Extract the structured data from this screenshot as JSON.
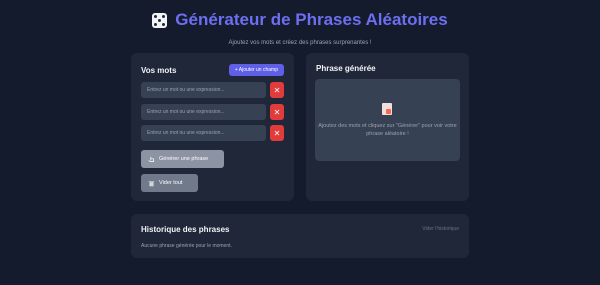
{
  "header": {
    "title": "Générateur de Phrases Aléatoires",
    "subtitle": "Ajoutez vos mots et créez des phrases surprenantes !"
  },
  "words_panel": {
    "title": "Vos mots",
    "add_label": "+ Ajouter un champ",
    "inputs": [
      {
        "placeholder": "Entrez un mot ou une expression...",
        "value": ""
      },
      {
        "placeholder": "Entrez un mot ou une expression...",
        "value": ""
      },
      {
        "placeholder": "Entrez un mot ou une expression...",
        "value": ""
      }
    ],
    "delete_glyph": "✕",
    "generate_label": "Générer une phrase",
    "clear_label": "Vider tout"
  },
  "phrase_panel": {
    "title": "Phrase générée",
    "empty_message": "Ajoutez des mots et cliquez sur \"Générer\" pour voir votre phrase aléatoire !"
  },
  "history": {
    "title": "Historique des phrases",
    "clear_label": "Vider l'historique",
    "empty_message": "Aucune phrase générée pour le moment."
  },
  "colors": {
    "background": "#141b2d",
    "card": "#1f2739",
    "accent": "#5f5fe8",
    "danger": "#e23b3b",
    "title": "#6d6ff0"
  },
  "icons": {
    "title": "dice-icon",
    "generate": "hand-pointer-icon",
    "clear": "trash-icon",
    "empty_phrase": "document-icon",
    "delete": "close-icon"
  }
}
